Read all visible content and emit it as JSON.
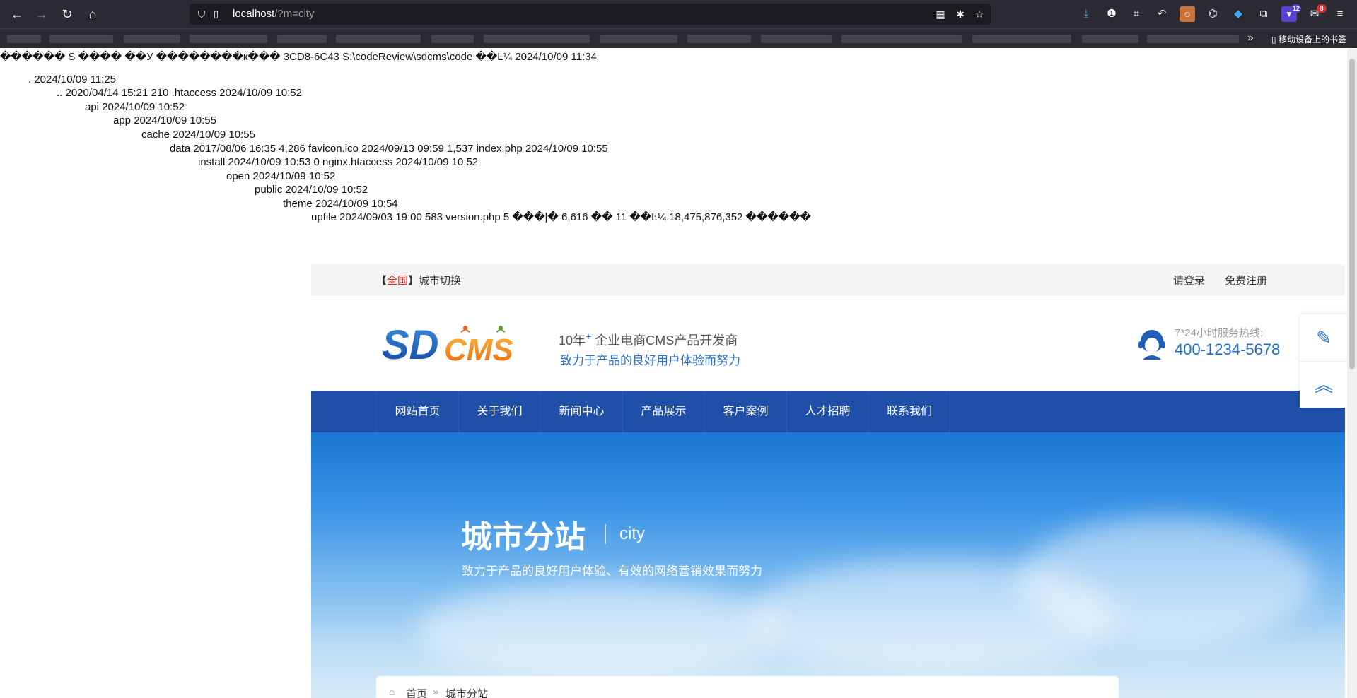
{
  "browser": {
    "url_host": "localhost",
    "url_path": "/?m=city",
    "mobile_bookmarks_label": "移动设备上的书签",
    "badge_counts": [
      "12",
      "8"
    ]
  },
  "dir_listing": {
    "header": "������ S ���� ��У ��������к��� 3CD8-6C43 S:\\codeReview\\sdcms\\code ��Ŀ¼ 2024/10/09 11:34",
    "lines": [
      ". 2024/10/09 11:25",
      ".. 2020/04/14 15:21 210 .htaccess 2024/10/09 10:52",
      "api 2024/10/09 10:52",
      "app 2024/10/09 10:55",
      "cache 2024/10/09 10:55",
      "data 2017/08/06 16:35 4,286 favicon.ico 2024/09/13 09:59 1,537 index.php 2024/10/09 10:55",
      "install 2024/10/09 10:53 0 nginx.htaccess 2024/10/09 10:52",
      "open 2024/10/09 10:52",
      "public 2024/10/09 10:52",
      "theme 2024/10/09 10:54",
      "upfile 2024/09/03 19:00 583 version.php 5 ���|� 6,616 �� 11 ��Ŀ¼ 18,475,876,352 ������"
    ]
  },
  "site": {
    "topbar": {
      "city_bracket_open": "【",
      "city_name": "全国",
      "city_bracket_close": "】",
      "city_switch": "城市切换",
      "login": "请登录",
      "register": "免费注册"
    },
    "header": {
      "slogan_years": "10年",
      "slogan_plus": "+",
      "slogan_rest": " 企业电商CMS产品开发商",
      "slogan2": "致力于产品的良好用户体验而努力",
      "hotline_label": "7*24小时服务热线:",
      "hotline_number": "400-1234-5678"
    },
    "nav": [
      "网站首页",
      "关于我们",
      "新闻中心",
      "产品展示",
      "客户案例",
      "人才招聘",
      "联系我们"
    ],
    "banner": {
      "title": "城市分站",
      "subtitle": "city",
      "description": "致力于产品的良好用户体验、有效的网络营销效果而努力"
    },
    "breadcrumb": {
      "home": "首页",
      "current": "城市分站"
    }
  },
  "colors": {
    "nav_bg": "#1f4fa8",
    "accent_blue": "#1f6fd1",
    "city_red": "#e2231a"
  },
  "icons": {
    "side_top": "edit-icon",
    "side_bottom": "back-to-top-icon"
  }
}
